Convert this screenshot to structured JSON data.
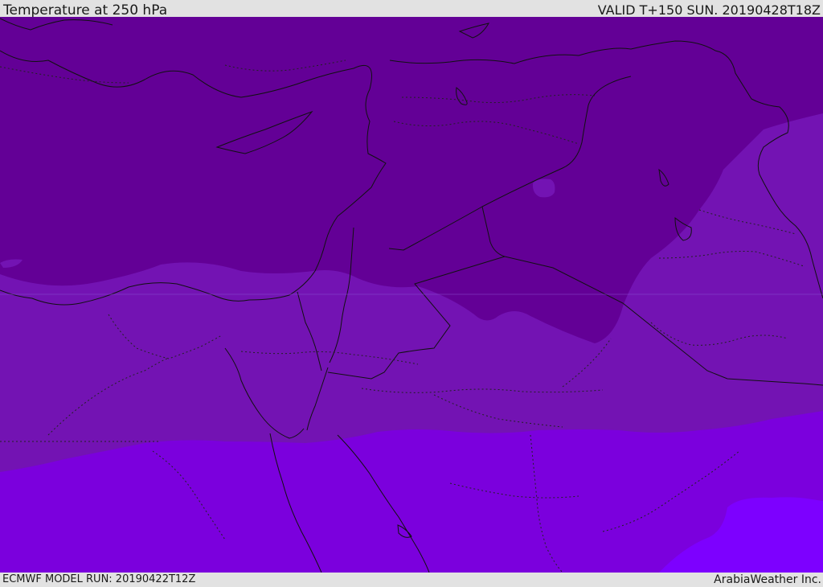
{
  "header": {
    "title": "Temperature at 250 hPa",
    "valid": "VALID T+150 SUN. 20190428T18Z"
  },
  "footer": {
    "model_run": "ECMWF MODEL RUN: 20190422T12Z",
    "credit": "ArabiaWeather Inc."
  },
  "map": {
    "variable": "temperature",
    "level": "250 hPa",
    "colors": {
      "band_coldest": "#630096",
      "band_cold": "#7313b3",
      "band_mild": "#7b00dd",
      "band_warm": "#7d00ff",
      "border_line": "#111111",
      "province_line": "#222222"
    }
  }
}
